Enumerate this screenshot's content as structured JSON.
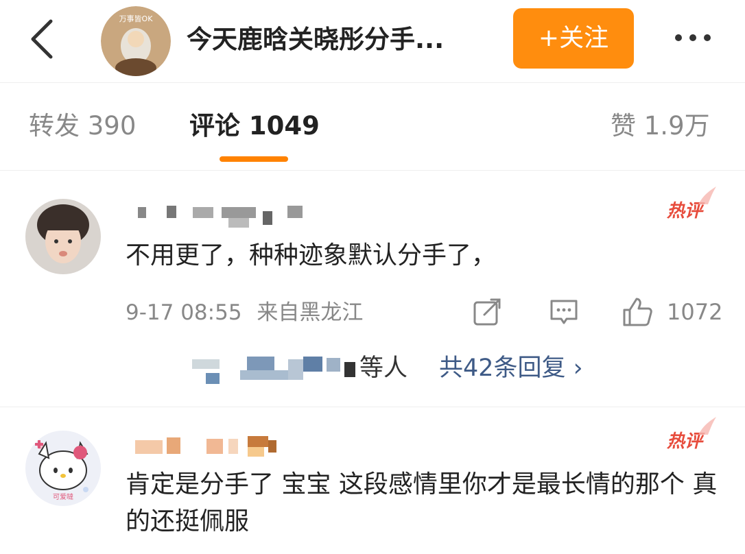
{
  "header": {
    "title": "今天鹿晗关晓彤分手...",
    "avatar_caption": "万事皆OK",
    "follow_label": "+关注"
  },
  "tabs": {
    "repost": "转发 390",
    "comment": "评论 1049",
    "like": "赞 1.9万"
  },
  "colors": {
    "accent": "#ff8200",
    "follow_button": "#ff8d0e",
    "hot_badge": "#e74c3c",
    "link": "#3e5a86"
  },
  "comments": [
    {
      "hot_label": "热评",
      "text": "不用更了，种种迹象默认分手了，",
      "time": "9-17 08:55",
      "location": "来自黑龙江",
      "like_count": "1072",
      "replies_suffix": "等人",
      "replies_link": "共42条回复 ›"
    },
    {
      "hot_label": "热评",
      "text": "肯定是分手了 宝宝 这段感情里你才是最长情的那个 真的还挺佩服",
      "avatar_caption": "可爱噠"
    }
  ],
  "icons": [
    "back-icon",
    "more-icon",
    "share-icon",
    "comment-icon",
    "thumbs-up-icon",
    "chevron-right-icon"
  ]
}
